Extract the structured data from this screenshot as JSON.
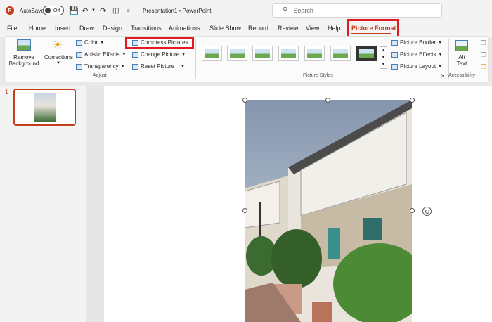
{
  "titlebar": {
    "autosave_label": "AutoSave",
    "autosave_state": "Off",
    "document_title": "Presentation1 • PowerPoint",
    "search_placeholder": "Search"
  },
  "tabs": [
    "File",
    "Home",
    "Insert",
    "Draw",
    "Design",
    "Transitions",
    "Animations",
    "Slide Show",
    "Record",
    "Review",
    "View",
    "Help",
    "Picture Format"
  ],
  "active_tab": "Picture Format",
  "ribbon": {
    "remove_background": [
      "Remove",
      "Background"
    ],
    "corrections": "Corrections",
    "color": "Color",
    "artistic_effects": "Artistic Effects",
    "transparency": "Transparency",
    "compress_pictures": "Compress Pictures",
    "change_picture": "Change Picture",
    "reset_picture": "Reset Picture",
    "adjust_group": "Adjust",
    "picture_styles_group": "Picture Styles",
    "picture_border": "Picture Border",
    "picture_effects": "Picture Effects",
    "picture_layout": "Picture Layout",
    "alt_text": [
      "Alt",
      "Text"
    ],
    "accessibility_group": "Accessibility"
  },
  "slides": [
    {
      "number": "1"
    }
  ],
  "colors": {
    "accent": "#c43e1c",
    "highlight_box": "#e01b24"
  }
}
